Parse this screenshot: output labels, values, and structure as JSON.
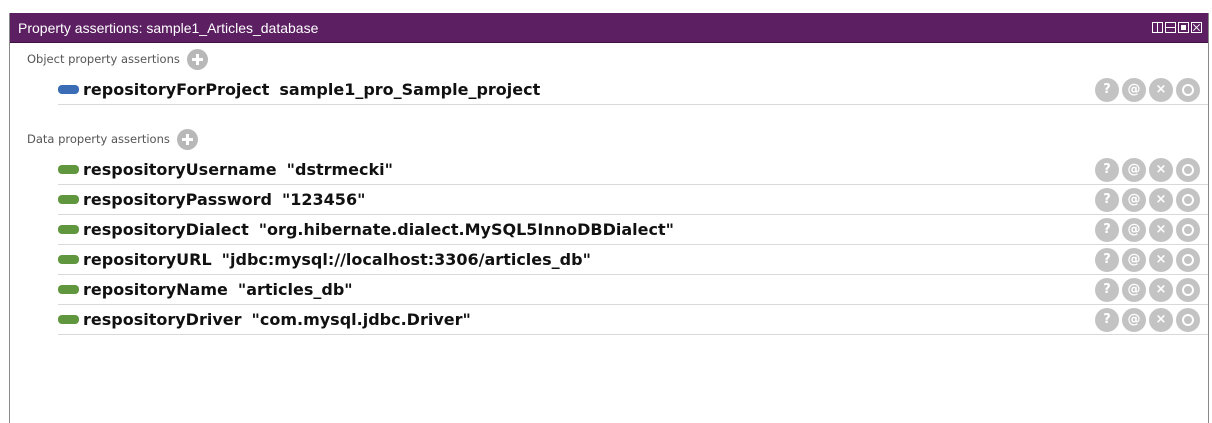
{
  "panel": {
    "title": "Property assertions: sample1_Articles_database"
  },
  "object_section": {
    "label": "Object property assertions",
    "rows": [
      {
        "name": "repositoryForProject",
        "value": "sample1_pro_Sample_project"
      }
    ]
  },
  "data_section": {
    "label": "Data property assertions",
    "rows": [
      {
        "name": "respositoryUsername",
        "value": "\"dstrmecki\""
      },
      {
        "name": "respositoryPassword",
        "value": "\"123456\""
      },
      {
        "name": "respositoryDialect",
        "value": "\"org.hibernate.dialect.MySQL5InnoDBDialect\""
      },
      {
        "name": "repositoryURL",
        "value": "\"jdbc:mysql://localhost:3306/articles_db\""
      },
      {
        "name": "repositoryName",
        "value": "\"articles_db\""
      },
      {
        "name": "respositoryDriver",
        "value": "\"com.mysql.jdbc.Driver\""
      }
    ]
  },
  "row_actions": {
    "help": "?",
    "annotate": "@",
    "delete": "×",
    "edit": ""
  },
  "colors": {
    "titlebar": "#5b1f62",
    "object_icon": "#3a6db5",
    "data_icon": "#5f963e",
    "action_button": "#c3c3c3"
  }
}
